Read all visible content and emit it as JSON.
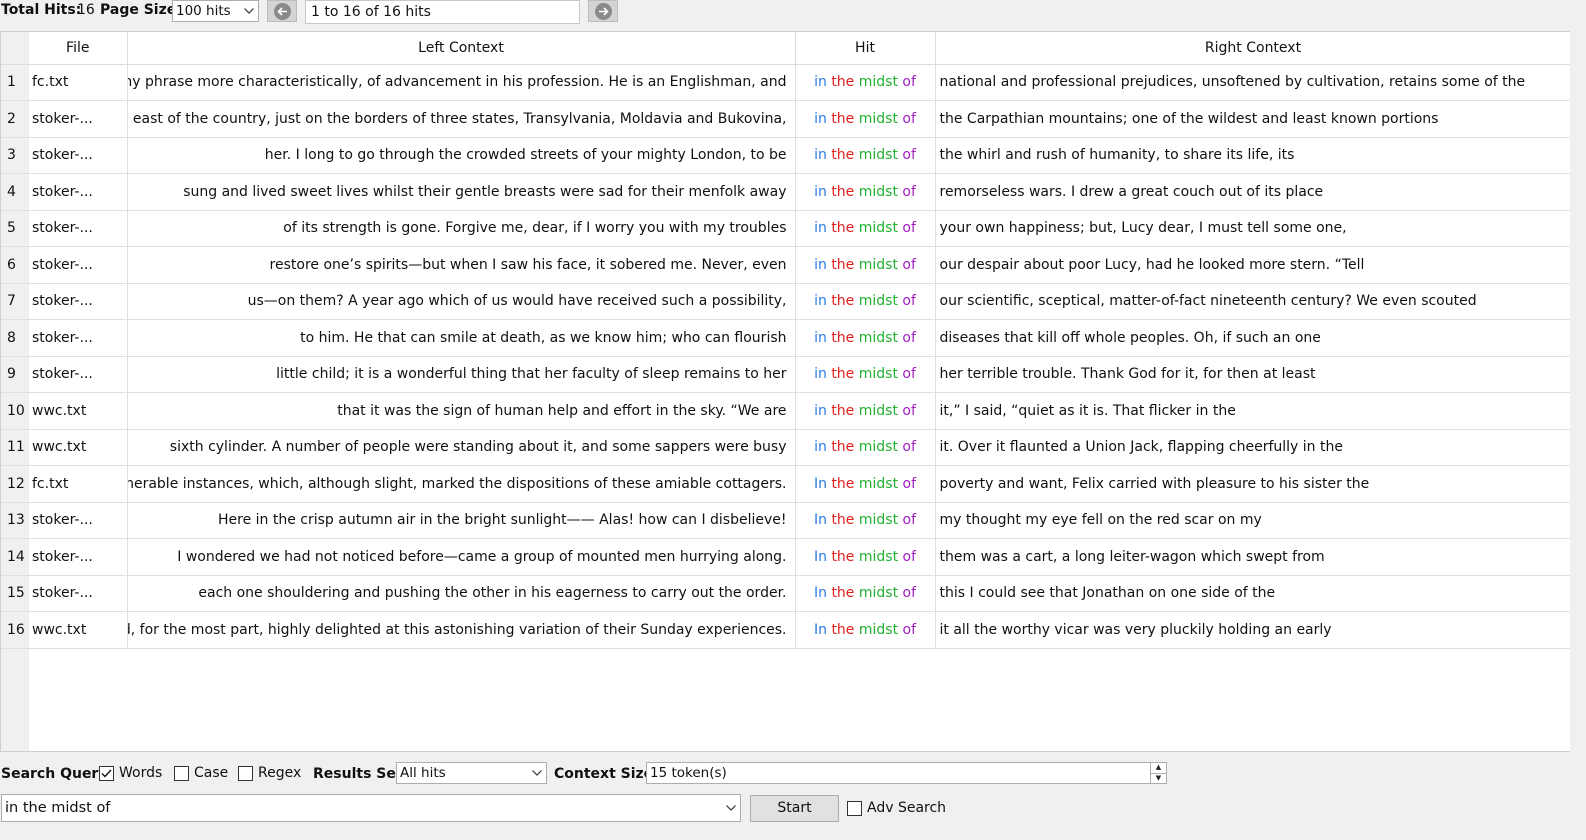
{
  "toolbar": {
    "total_hits_label": "Total Hits:",
    "total_hits_value": "16",
    "page_size_label": "Page Size",
    "page_size_value": "100 hits",
    "range_text": "1 to 16 of 16 hits"
  },
  "table": {
    "columns": [
      "File",
      "Left Context",
      "Hit",
      "Right Context"
    ],
    "hit_words": [
      "in",
      "the",
      "midst",
      "of"
    ],
    "rows": [
      {
        "n": "1",
        "file": "fc.txt",
        "left": "word my phrase more characteristically, of advancement in his profession. He is an Englishman, and",
        "hit": [
          "in",
          "the",
          "midst",
          "of"
        ],
        "right": "national and professional prejudices, unsoftened by cultivation, retains some of the"
      },
      {
        "n": "2",
        "file": "stoker-...",
        "left": "east of the country, just on the borders of three states, Transylvania, Moldavia and Bukovina,",
        "hit": [
          "in",
          "the",
          "midst",
          "of"
        ],
        "right": "the Carpathian mountains; one of the wildest and least known portions"
      },
      {
        "n": "3",
        "file": "stoker-...",
        "left": "her. I long to go through the crowded streets of your mighty London, to be",
        "hit": [
          "in",
          "the",
          "midst",
          "of"
        ],
        "right": "the whirl and rush of humanity, to share its life, its"
      },
      {
        "n": "4",
        "file": "stoker-...",
        "left": "sung and lived sweet lives whilst their gentle breasts were sad for their menfolk away",
        "hit": [
          "in",
          "the",
          "midst",
          "of"
        ],
        "right": "remorseless wars. I drew a great couch out of its place"
      },
      {
        "n": "5",
        "file": "stoker-...",
        "left": "of its strength is gone. Forgive me, dear, if I worry you with my troubles",
        "hit": [
          "in",
          "the",
          "midst",
          "of"
        ],
        "right": "your own happiness; but, Lucy dear, I must tell some one,"
      },
      {
        "n": "6",
        "file": "stoker-...",
        "left": "restore one’s spirits—but when I saw his face, it sobered me. Never, even",
        "hit": [
          "in",
          "the",
          "midst",
          "of"
        ],
        "right": "our despair about poor Lucy, had he looked more stern. “Tell"
      },
      {
        "n": "7",
        "file": "stoker-...",
        "left": "us—on them? A year ago which of us would have received such a possibility,",
        "hit": [
          "in",
          "the",
          "midst",
          "of"
        ],
        "right": "our scientific, sceptical, matter-of-fact nineteenth century? We even scouted"
      },
      {
        "n": "8",
        "file": "stoker-...",
        "left": "to him. He that can smile at death, as we know him; who can flourish",
        "hit": [
          "in",
          "the",
          "midst",
          "of"
        ],
        "right": "diseases that kill off whole peoples. Oh, if such an one"
      },
      {
        "n": "9",
        "file": "stoker-...",
        "left": "little child; it is a wonderful thing that her faculty of sleep remains to her",
        "hit": [
          "in",
          "the",
          "midst",
          "of"
        ],
        "right": "her terrible trouble. Thank God for it, for then at least"
      },
      {
        "n": "10",
        "file": "wwc.txt",
        "left": "that it was the sign of human help and effort in the sky. “We are",
        "hit": [
          "in",
          "the",
          "midst",
          "of"
        ],
        "right": "it,” I said, “quiet as it is. That flicker in the"
      },
      {
        "n": "11",
        "file": "wwc.txt",
        "left": "sixth cylinder. A number of people were standing about it, and some sappers were busy",
        "hit": [
          "in",
          "the",
          "midst",
          "of"
        ],
        "right": "it. Over it flaunted a Union Jack, flapping cheerfully in the"
      },
      {
        "n": "12",
        "file": "fc.txt",
        "left": "on innumerable instances, which, although slight, marked the dispositions of these amiable cottagers.",
        "hit": [
          "In",
          "the",
          "midst",
          "of"
        ],
        "right": "poverty and want, Felix carried with pleasure to his sister the"
      },
      {
        "n": "13",
        "file": "stoker-...",
        "left": "Here in the crisp autumn air in the bright sunlight—— Alas! how can I disbelieve!",
        "hit": [
          "In",
          "the",
          "midst",
          "of"
        ],
        "right": "my thought my eye fell on the red scar on my"
      },
      {
        "n": "14",
        "file": "stoker-...",
        "left": "I wondered we had not noticed before—came a group of mounted men hurrying along.",
        "hit": [
          "In",
          "the",
          "midst",
          "of"
        ],
        "right": "them was a cart, a long leiter-wagon which swept from"
      },
      {
        "n": "15",
        "file": "stoker-...",
        "left": "each one shouldering and pushing the other in his eagerness to carry out the order.",
        "hit": [
          "In",
          "the",
          "midst",
          "of"
        ],
        "right": "this I could see that Jonathan on one side of the"
      },
      {
        "n": "16",
        "file": "wwc.txt",
        "left": "and, for the most part, highly delighted at this astonishing variation of their Sunday experiences.",
        "hit": [
          "In",
          "the",
          "midst",
          "of"
        ],
        "right": "it all the worthy vicar was very pluckily holding an early"
      }
    ]
  },
  "search": {
    "search_query_label": "Search Query",
    "words_label": "Words",
    "words_checked": true,
    "case_label": "Case",
    "case_checked": false,
    "regex_label": "Regex",
    "regex_checked": false,
    "results_set_label": "Results Set",
    "results_set_value": "All hits",
    "context_size_label": "Context Size",
    "context_size_value": "15 token(s)",
    "query_value": "in the midst of",
    "start_label": "Start",
    "adv_search_label": "Adv Search",
    "adv_search_checked": false
  },
  "colors": {
    "hit_word_1": "#2b7be4",
    "hit_word_2": "#e02020",
    "hit_word_3": "#22b030",
    "hit_word_4": "#a020c0"
  },
  "icons": {
    "prev_page": "circle-arrow-left-icon",
    "next_page": "circle-arrow-right-icon",
    "dropdown": "chevron-down-icon",
    "spinner": "spinner-arrows-icon",
    "checkmark": "checkmark-icon"
  }
}
